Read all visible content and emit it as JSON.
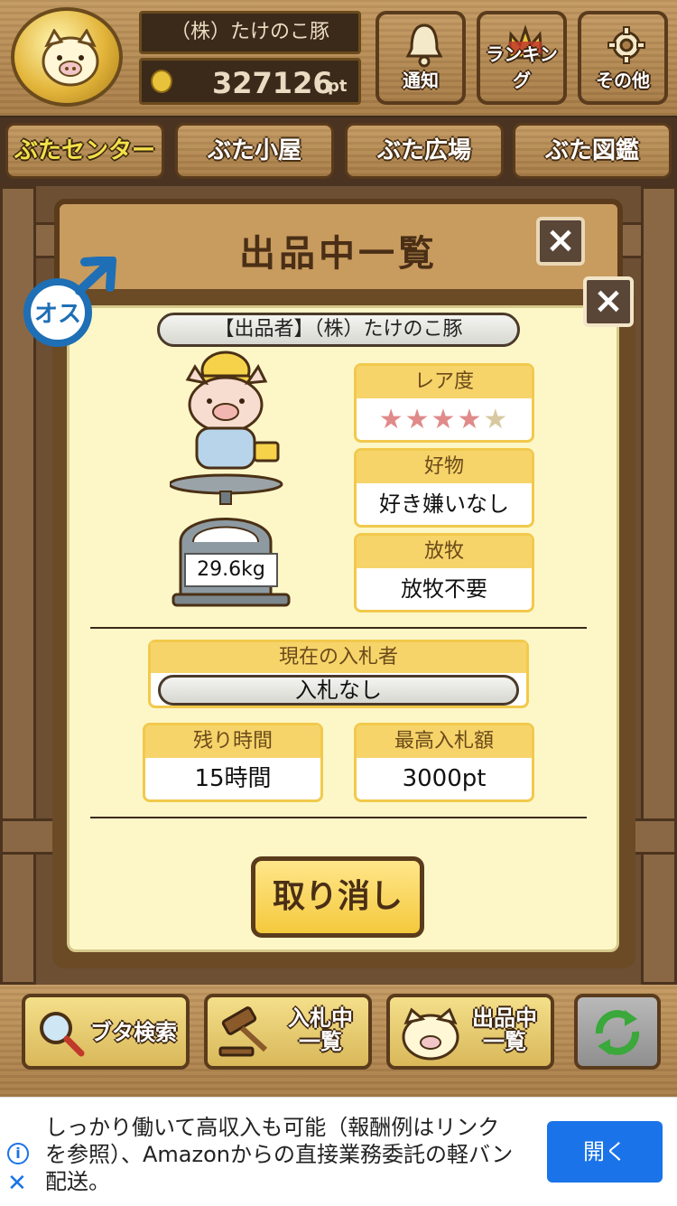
{
  "header": {
    "company": "（株）たけのこ豚",
    "points": "327126",
    "points_unit": "pt",
    "buttons": [
      {
        "label": "通知",
        "icon": "bell-icon"
      },
      {
        "label": "ランキング",
        "icon": "crown-icon"
      },
      {
        "label": "その他",
        "icon": "gear-icon"
      }
    ]
  },
  "tabs": [
    {
      "label": "ぶたセンター",
      "active": true
    },
    {
      "label": "ぶた小屋",
      "active": false
    },
    {
      "label": "ぶた広場",
      "active": false
    },
    {
      "label": "ぶた図鑑",
      "active": false
    }
  ],
  "list_panel": {
    "title": "出品中一覧",
    "close": "×"
  },
  "detail": {
    "gender": "オス",
    "seller": "【出品者】（株）たけのこ豚",
    "weight": "29.6kg",
    "rarity": {
      "label": "レア度",
      "stars": 4,
      "max": 5
    },
    "favorite": {
      "label": "好物",
      "value": "好き嫌いなし"
    },
    "grazing": {
      "label": "放牧",
      "value": "放牧不要"
    },
    "bidder": {
      "label": "現在の入札者",
      "value": "入札なし"
    },
    "remaining": {
      "label": "残り時間",
      "value": "15時間"
    },
    "highest_bid": {
      "label": "最高入札額",
      "value": "3000pt"
    },
    "cancel": "取り消し",
    "close": "×"
  },
  "bottom": {
    "search": "ブタ検索",
    "bidding": "入札中一覧",
    "listing": "出品中一覧"
  },
  "ad": {
    "text": "しっかり働いて高収入も可能（報酬例はリンクを参照）、Amazonからの直接業務委託の軽バン配送。",
    "button": "開く"
  },
  "colors": {
    "accent": "#f6d46a",
    "panel": "#fdf7c8",
    "wood": "#5a3b1c",
    "ad_button": "#1a73e8"
  }
}
